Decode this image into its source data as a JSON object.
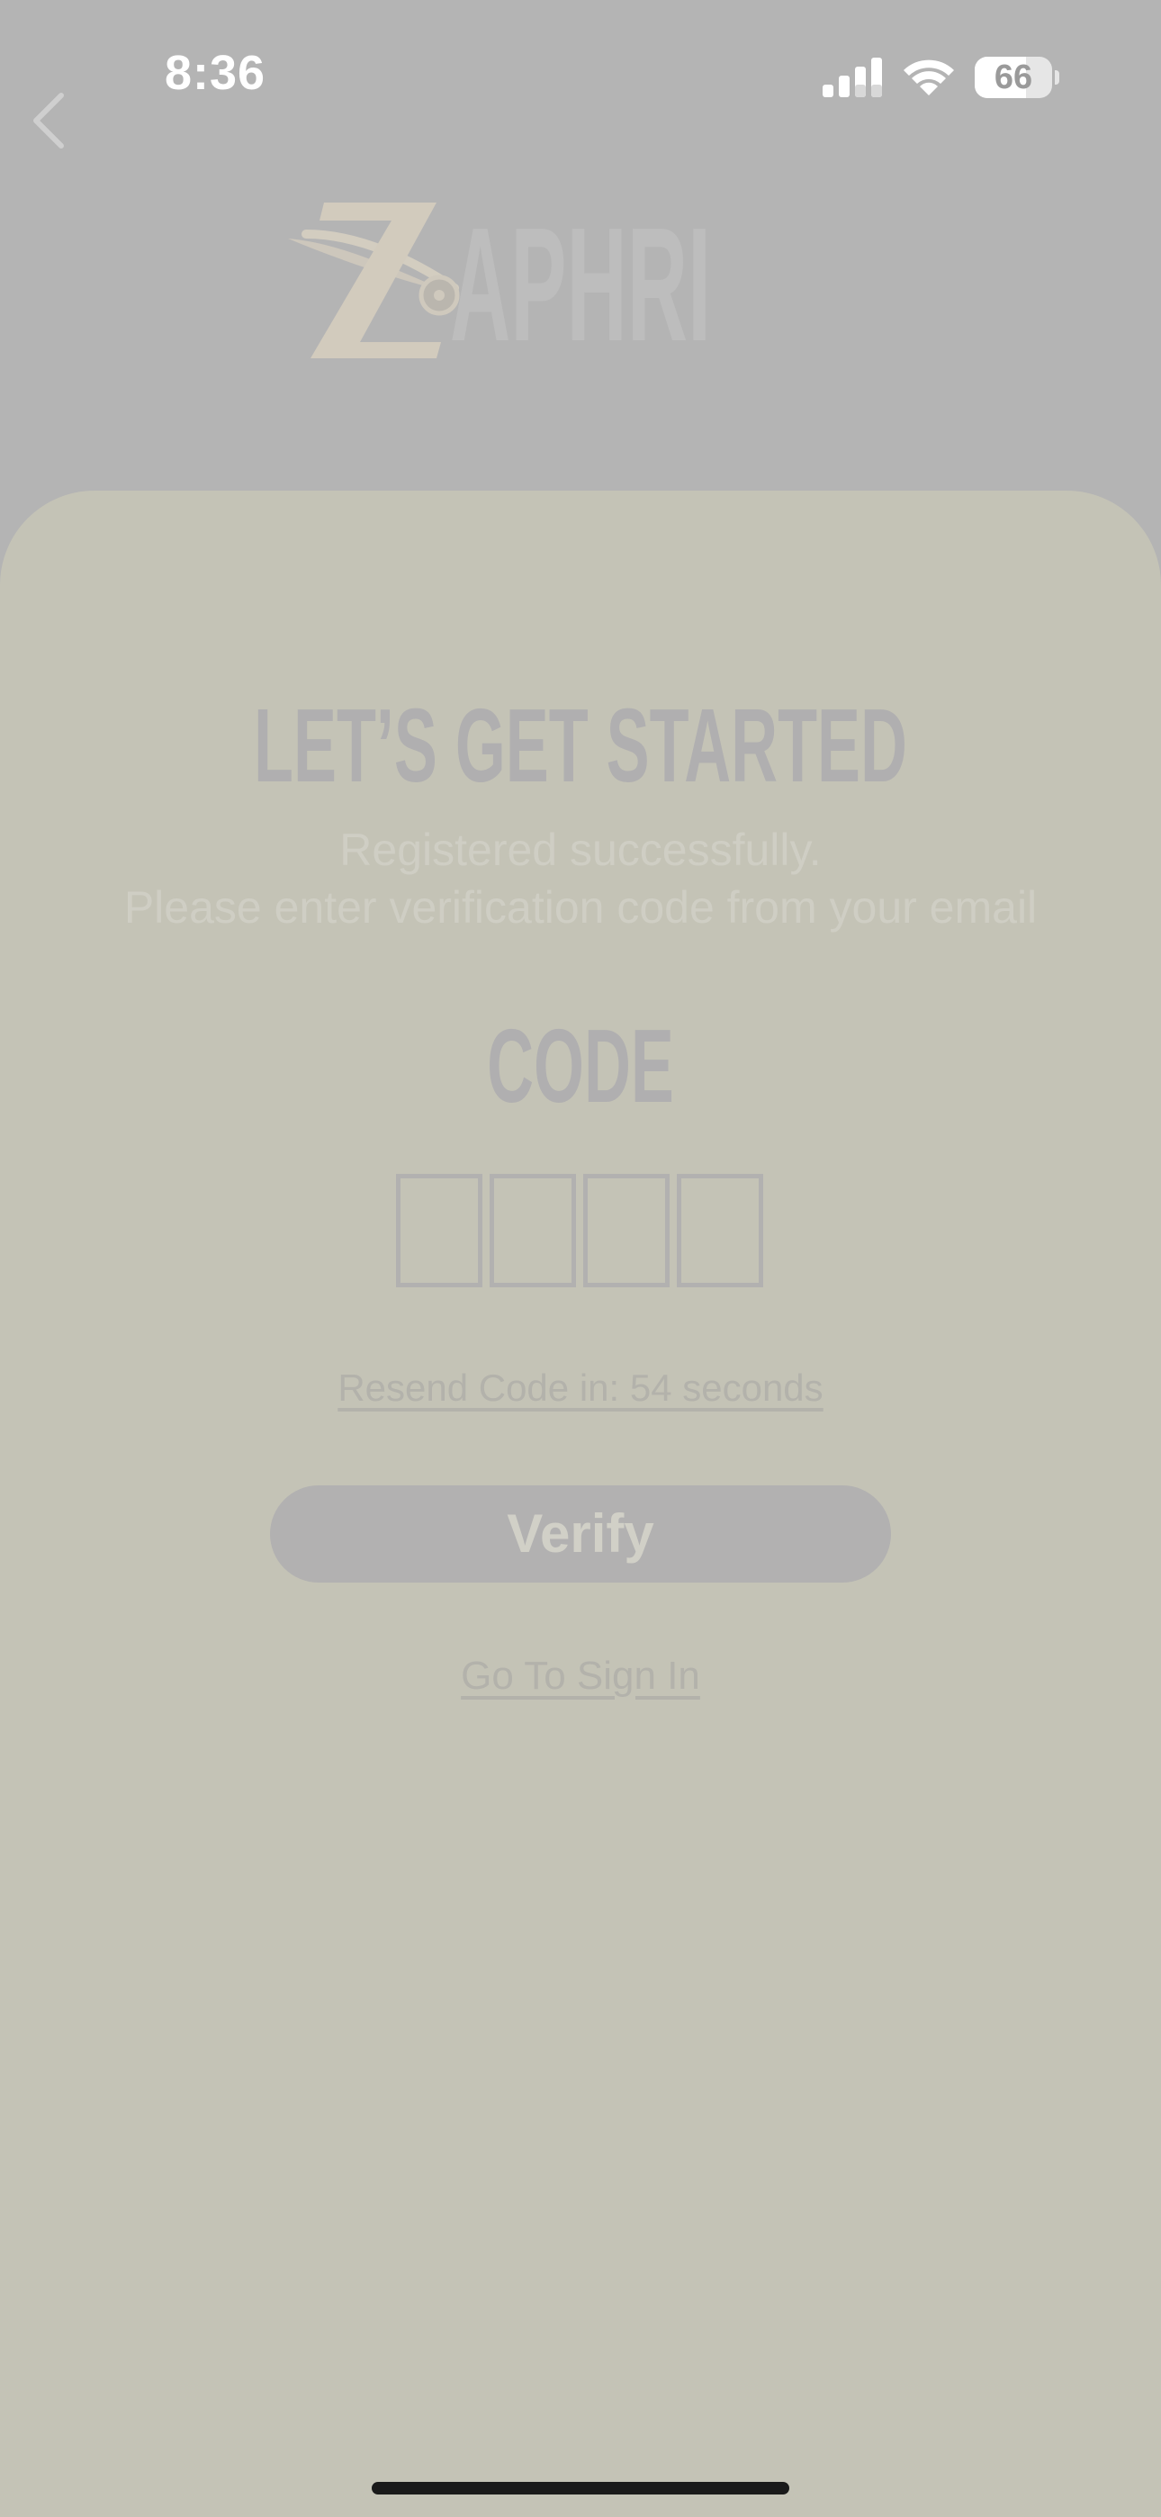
{
  "status_bar": {
    "time": "8:36",
    "battery_level": "66",
    "battery_fraction": 0.66,
    "icons": [
      "cellular-signal-icon",
      "wifi-icon",
      "battery-icon"
    ]
  },
  "header": {
    "back_icon": "chevron-left-icon",
    "logo_text": "ZAPHRI"
  },
  "main": {
    "title": "LET’S GET STARTED",
    "subtitle_line1": "Registered successfully.",
    "subtitle_line2": "Please enter verification code from your email",
    "code_label": "CODE",
    "code_digits": [
      "",
      "",
      "",
      ""
    ],
    "resend_text": "Resend Code in: 54 seconds",
    "verify_label": "Verify",
    "sign_in_link": "Go To Sign In"
  },
  "colors": {
    "background_top": "#b4b4b4",
    "card_background": "#c4c3b6",
    "button_background": "#b2b1b1",
    "home_indicator": "#1a1a1a"
  }
}
